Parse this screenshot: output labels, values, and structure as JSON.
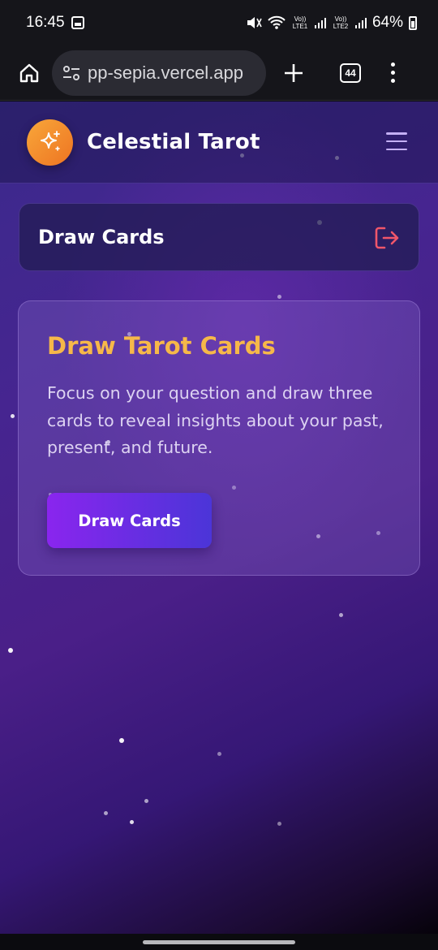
{
  "status_bar": {
    "time": "16:45",
    "battery": "64%",
    "sim1_label": "Vo)) LTE1",
    "sim2_label": "Vo)) LTE2"
  },
  "browser": {
    "url": "pp-sepia.vercel.app",
    "tab_count": "44"
  },
  "app": {
    "brand": "Celestial Tarot",
    "page_title": "Draw Cards",
    "card": {
      "title": "Draw Tarot Cards",
      "description": "Focus on your question and draw three cards to reveal insights about your past, present, and future.",
      "button_label": "Draw Cards"
    }
  },
  "colors": {
    "accent_gold": "#f6b849",
    "button_gradient_start": "#8a25ee",
    "button_gradient_end": "#4b35d8",
    "logo_orange": "#f19034",
    "logout_icon": "#f0566a"
  },
  "icons": {
    "home": "home-icon",
    "site_settings": "tune-icon",
    "new_tab": "plus-icon",
    "tabs": "tab-switcher-icon",
    "browser_menu": "more-vert-icon",
    "logo": "sparkles-icon",
    "app_menu": "hamburger-icon",
    "logout": "logout-icon"
  }
}
